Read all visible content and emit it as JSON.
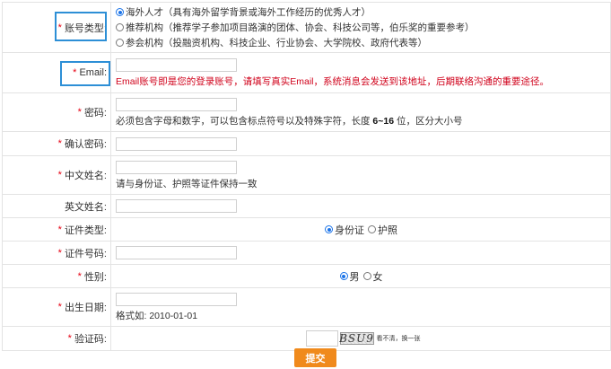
{
  "required_mark": "*",
  "account_type": {
    "label": "账号类型:",
    "options": [
      {
        "text": "海外人才（具有海外留学背景或海外工作经历的优秀人才）",
        "checked": true
      },
      {
        "text": "推荐机构（推荐学子参加项目路演的团体、协会、科技公司等，伯乐奖的重要参考）",
        "checked": false
      },
      {
        "text": "参会机构（投融资机构、科技企业、行业协会、大学院校、政府代表等）",
        "checked": false
      }
    ]
  },
  "email": {
    "label": "Email:",
    "warning": "Email账号即是您的登录账号，请填写真实Email，系统消息会发送到该地址，后期联络沟通的重要途径。"
  },
  "password": {
    "label": "密码:",
    "hint_pre": "必须包含字母和数字，可以包含标点符号以及特殊字符，长度 ",
    "hint_bold": "6~16",
    "hint_post": " 位，区分大小号"
  },
  "confirm_password": {
    "label": "确认密码:"
  },
  "chinese_name": {
    "label": "中文姓名:",
    "hint": "请与身份证、护照等证件保持一致"
  },
  "english_name": {
    "label": "英文姓名:"
  },
  "id_type": {
    "label": "证件类型:",
    "options": [
      {
        "text": "身份证",
        "checked": true
      },
      {
        "text": "护照",
        "checked": false
      }
    ]
  },
  "id_number": {
    "label": "证件号码:"
  },
  "gender": {
    "label": "性别:",
    "options": [
      {
        "text": "男",
        "checked": true
      },
      {
        "text": "女",
        "checked": false
      }
    ]
  },
  "birth_date": {
    "label": "出生日期:",
    "hint": "格式如:  2010-01-01"
  },
  "captcha": {
    "label": "验证码:",
    "image_text": "BSU9",
    "refresh_text": "看不清，换一张"
  },
  "submit": {
    "label": "提交"
  },
  "colors": {
    "required": "#e60012",
    "warning": "#d0021b",
    "highlight": "#2d8fd6",
    "submit_bg": "#f08a1c"
  }
}
